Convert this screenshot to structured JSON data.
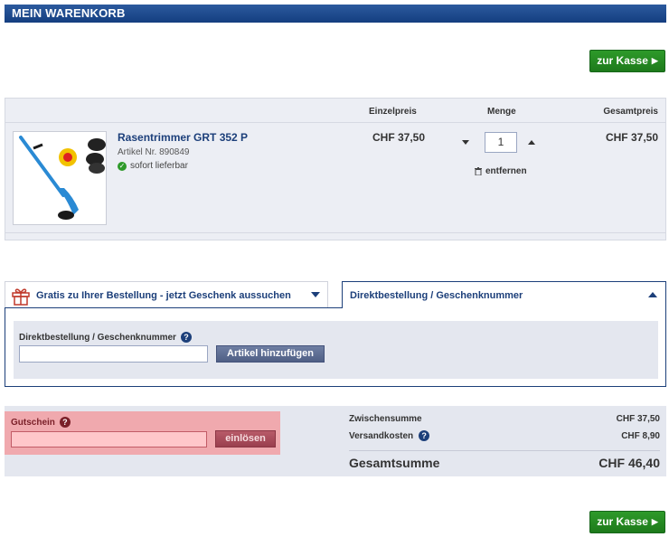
{
  "header": {
    "title": "MEIN WARENKORB"
  },
  "checkout": {
    "label": "zur Kasse",
    "color": "#25891f"
  },
  "cart": {
    "columns": {
      "unit_price": "Einzelpreis",
      "quantity": "Menge",
      "total_price": "Gesamtpreis"
    },
    "item": {
      "title": "Rasentrimmer GRT 352 P",
      "article": "Artikel Nr. 890849",
      "availability": "sofort lieferbar",
      "unit_price": "CHF 37,50",
      "quantity": "1",
      "remove_label": "entfernen",
      "total_price": "CHF 37,50"
    }
  },
  "tabs": {
    "gift": {
      "label": "Gratis zu Ihrer Bestellung - jetzt Geschenk aussuchen",
      "icon": "gift-icon"
    },
    "direct": {
      "label": "Direktbestellung / Geschenknummer",
      "icon": "caret-up-icon"
    }
  },
  "direct_order": {
    "field_label": "Direktbestellung / Geschenknummer",
    "input_value": "",
    "button_label": "Artikel hinzufügen"
  },
  "coupon": {
    "label": "Gutschein",
    "input_value": "",
    "button_label": "einlösen",
    "highlight_color": "#f0a9ae"
  },
  "summary": {
    "subtotal_label": "Zwischensumme",
    "subtotal_value": "CHF 37,50",
    "shipping_label": "Versandkosten",
    "shipping_value": "CHF 8,90",
    "total_label": "Gesamtsumme",
    "total_value": "CHF 46,40"
  },
  "colors": {
    "brand": "#1c3f7a",
    "accent_green": "#25891f"
  }
}
